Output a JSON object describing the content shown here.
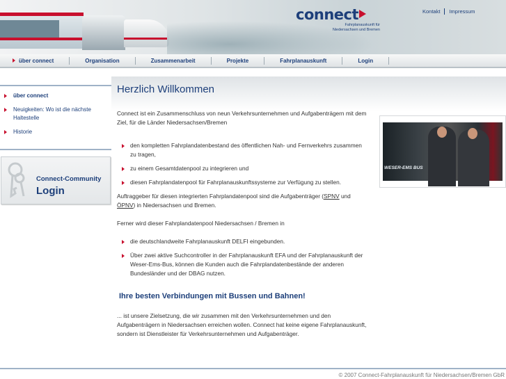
{
  "header": {
    "logo": "connect",
    "logo_sub_1": "Fahrplanauskunft für",
    "logo_sub_2": "Niedersachsen und Bremen",
    "links": [
      "Kontakt",
      "Impressum"
    ]
  },
  "nav": [
    "über connect",
    "Organisation",
    "Zusammenarbeit",
    "Projekte",
    "Fahrplanauskunft",
    "Login"
  ],
  "sidebar": {
    "items": [
      "über connect",
      "Neuigkeiten: Wo ist die nächste Haltestelle",
      "Historie"
    ],
    "login_title": "Connect-Community",
    "login_label": "Login"
  },
  "main": {
    "title": "Herzlich Willkommen",
    "intro": "Connect ist ein Zusammenschluss von neun Verkehrsunternehmen und Aufgabenträgern mit dem Ziel, für die Länder Niedersachsen/Bremen",
    "bullets1": [
      "den kompletten Fahrplandatenbestand des öffentlichen Nah- und Fernverkehrs zusammen zu tragen,",
      "zu einem Gesamtdatenpool zu integrieren und",
      "diesen Fahrplandatenpool für Fahrplanauskunftssysteme zur Verfügung zu stellen."
    ],
    "p2_a": "Auftraggeber für diesen integrierten Fahrplandatenpool sind die Aufgabenträger (",
    "p2_link1": "SPNV",
    "p2_b": " und ",
    "p2_link2": "ÖPNV",
    "p2_c": ") in Niedersachsen und Bremen.",
    "p3": "Ferner wird dieser Fahrplandatenpool Niedersachsen / Bremen in",
    "bullets2": [
      "die deutschlandweite Fahrplanauskunft DELFI eingebunden.",
      "Über zwei aktive Suchcontroller in der Fahrplanauskunft EFA und der Fahrplanauskunft der Weser-Ems-Bus, können die Kunden auch die Fahrplandatenbestände der anderen Bundesländer und der DBAG nutzen."
    ],
    "subtitle": "Ihre besten Verbindungen mit Bussen und Bahnen!",
    "p4": "... ist unsere Zielsetzung, die wir zusammen mit den Verkehrsunternehmen und den Aufgabenträgern in Niedersachsen erreichen wollen. Connect hat keine eigene Fahrplanauskunft, sondern ist Dienstleister für Verkehrsunternehmen und Aufgabenträger."
  },
  "photo": {
    "bus_text": "WESER-EMS BUS"
  },
  "footer": "© 2007 Connect-Fahrplanauskunft für Niedersachsen/Bremen GbR"
}
